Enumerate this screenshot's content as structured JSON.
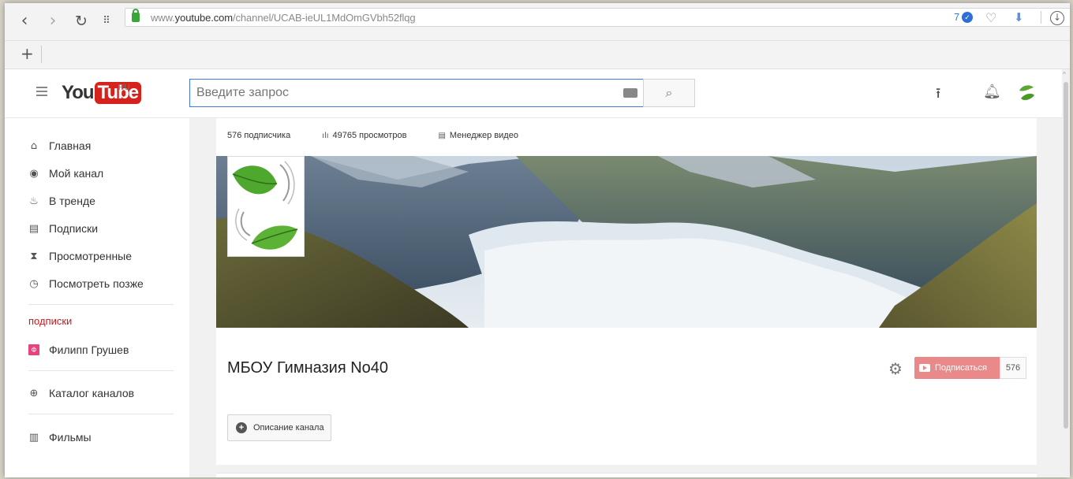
{
  "browser": {
    "url_prefix": "www.",
    "url_domain": "youtube.com",
    "url_path": "/channel/UCAB-ieUL1MdOmGVbh52flqg",
    "ext_count": "7",
    "new_tab": "+"
  },
  "header": {
    "logo_you": "You",
    "logo_tube": "Tube",
    "logo_region": "RU",
    "search_placeholder": "Введите запрос"
  },
  "sidebar": {
    "items": [
      {
        "label": "Главная",
        "icon": "home-icon"
      },
      {
        "label": "Мой канал",
        "icon": "user-icon"
      },
      {
        "label": "В тренде",
        "icon": "fire-icon"
      },
      {
        "label": "Подписки",
        "icon": "subscriptions-icon"
      },
      {
        "label": "Просмотренные",
        "icon": "hourglass-icon"
      },
      {
        "label": "Посмотреть позже",
        "icon": "clock-icon"
      }
    ],
    "section_title": "ПОДПИСКИ",
    "subscriptions": [
      {
        "label": "Филипп Грушев",
        "avatar_letter": "Ф"
      }
    ],
    "catalog": "Каталог каналов",
    "movies": "Фильмы"
  },
  "channel": {
    "subscribers": "576 подписчика",
    "views": "49765 просмотров",
    "video_manager": "Менеджер видео",
    "title": "МБОУ Гимназия No40",
    "subscribe_label": "Подписаться",
    "subscribe_count": "576",
    "description_button": "Описание канала"
  },
  "colors": {
    "accent_blue": "#3b7be0",
    "youtube_red": "#d6221c",
    "subscribe_pink": "#e9898a",
    "section_red": "#cc181e"
  }
}
